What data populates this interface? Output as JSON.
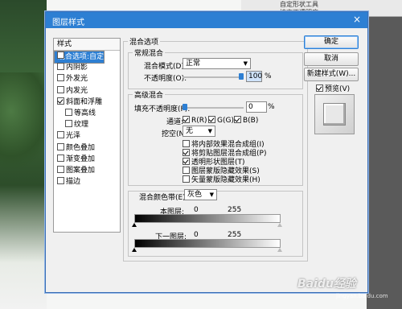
{
  "background": {
    "top_items": [
      "自定形状工具",
      "填充不透明度"
    ]
  },
  "dialog": {
    "title": "图层样式",
    "close": "×"
  },
  "style_list": {
    "header": "样式",
    "items": [
      {
        "label": "混合选项:自定",
        "checkbox": false,
        "checked": false,
        "indent": false,
        "selected": true
      },
      {
        "label": "投影",
        "checkbox": true,
        "checked": false,
        "indent": false,
        "selected": false
      },
      {
        "label": "内阴影",
        "checkbox": true,
        "checked": false,
        "indent": false,
        "selected": false
      },
      {
        "label": "外发光",
        "checkbox": true,
        "checked": false,
        "indent": false,
        "selected": false
      },
      {
        "label": "内发光",
        "checkbox": true,
        "checked": false,
        "indent": false,
        "selected": false
      },
      {
        "label": "斜面和浮雕",
        "checkbox": true,
        "checked": true,
        "indent": false,
        "selected": false
      },
      {
        "label": "等高线",
        "checkbox": true,
        "checked": false,
        "indent": true,
        "selected": false
      },
      {
        "label": "纹理",
        "checkbox": true,
        "checked": false,
        "indent": true,
        "selected": false
      },
      {
        "label": "光泽",
        "checkbox": true,
        "checked": false,
        "indent": false,
        "selected": false
      },
      {
        "label": "颜色叠加",
        "checkbox": true,
        "checked": false,
        "indent": false,
        "selected": false
      },
      {
        "label": "渐变叠加",
        "checkbox": true,
        "checked": false,
        "indent": false,
        "selected": false
      },
      {
        "label": "图案叠加",
        "checkbox": true,
        "checked": false,
        "indent": false,
        "selected": false
      },
      {
        "label": "描边",
        "checkbox": true,
        "checked": false,
        "indent": false,
        "selected": false
      }
    ]
  },
  "blend_options": {
    "title": "混合选项",
    "general": {
      "title": "常规混合",
      "blend_mode_label": "混合模式(D):",
      "blend_mode_value": "正常",
      "opacity_label": "不透明度(O):",
      "opacity_value": "100",
      "opacity_unit": "%",
      "opacity_level": 1.0
    },
    "advanced": {
      "title": "高级混合",
      "fill_label": "填充不透明度(F):",
      "fill_value": "0",
      "fill_unit": "%",
      "fill_level": 0.0,
      "channels_label": "通道:",
      "channels": [
        {
          "label": "R(R)",
          "checked": true
        },
        {
          "label": "G(G)",
          "checked": true
        },
        {
          "label": "B(B)",
          "checked": true
        }
      ],
      "knockout_label": "挖空(N):",
      "knockout_value": "无",
      "options": [
        {
          "label": "将内部效果混合成组(I)",
          "checked": false
        },
        {
          "label": "将剪贴图层混合成组(P)",
          "checked": true
        },
        {
          "label": "透明形状图层(T)",
          "checked": true
        },
        {
          "label": "图层蒙版隐藏效果(S)",
          "checked": false
        },
        {
          "label": "矢量蒙版隐藏效果(H)",
          "checked": false
        }
      ]
    },
    "blend_if": {
      "label": "混合颜色带(E):",
      "value": "灰色",
      "this_layer_label": "本图层:",
      "this_layer_min": "0",
      "this_layer_max": "255",
      "underlying_label": "下一图层:",
      "underlying_min": "0",
      "underlying_max": "255"
    }
  },
  "buttons": {
    "ok": "确定",
    "cancel": "取消",
    "new_style": "新建样式(W)...",
    "preview_label": "预览(V)",
    "preview_checked": true
  },
  "watermark": {
    "text": "Baidu经验",
    "url": "jingyan.baidu.com"
  },
  "colors": {
    "accent": "#2d7fd3",
    "title_bar": "#2d7fd3",
    "dialog_bg": "#f0f0f0"
  }
}
